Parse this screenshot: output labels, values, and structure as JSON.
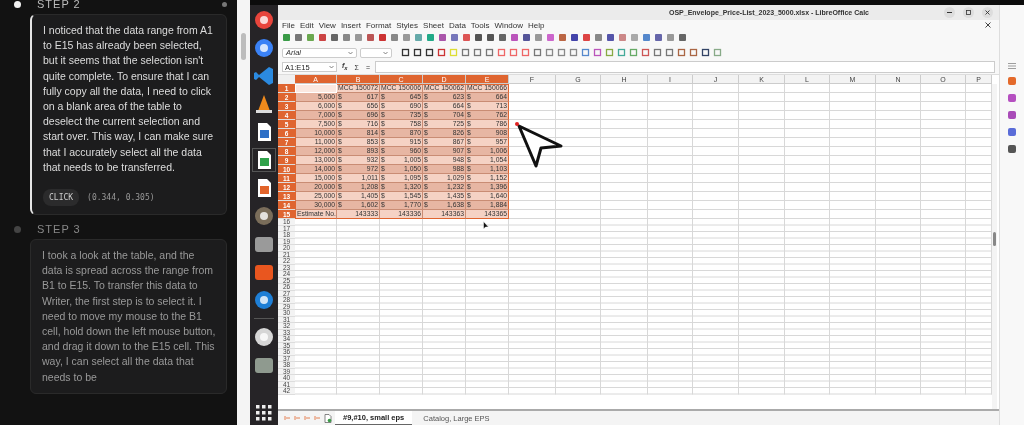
{
  "steps": [
    {
      "label": "STEP 2",
      "selected": true,
      "text": "I noticed that the data range from A1 to E15 has already been selected, but it seems that the selection isn't quite complete. To ensure that I can fully copy all the data, I need to click on a blank area of the table to deselect the current selection and start over. This way, I can make sure that I accurately select all the data that needs to be transferred.",
      "action": {
        "type": "CLICK",
        "coords": "(0.344, 0.305)"
      }
    },
    {
      "label": "STEP 3",
      "selected": false,
      "text": "I took a look at the table, and the data is spread across the range from B1 to E15. To transfer this data to Writer, the first step is to select it. I need to move my mouse to the B1 cell, hold down the left mouse button, and drag it down to the E15 cell. This way, I can select all the data that needs to be"
    }
  ],
  "window": {
    "title": "OSP_Envelope_Price-List_2023_5000.xlsx - LibreOffice Calc"
  },
  "menu": [
    "File",
    "Edit",
    "View",
    "Insert",
    "Format",
    "Styles",
    "Sheet",
    "Data",
    "Tools",
    "Window",
    "Help"
  ],
  "toolbar": {
    "font_name": "Arial"
  },
  "formula_bar": {
    "name_box": "A1:E15",
    "function_wizard": "f$_{x}$",
    "sum": "Σ",
    "equals": "="
  },
  "sheet": {
    "columns": [
      {
        "label": "A",
        "selected": true
      },
      {
        "label": "B",
        "selected": true
      },
      {
        "label": "C",
        "selected": true
      },
      {
        "label": "D",
        "selected": true
      },
      {
        "label": "E",
        "selected": true
      },
      {
        "label": "F",
        "selected": false
      },
      {
        "label": "G",
        "selected": false
      },
      {
        "label": "H",
        "selected": false
      },
      {
        "label": "I",
        "selected": false
      },
      {
        "label": "J",
        "selected": false
      },
      {
        "label": "K",
        "selected": false
      },
      {
        "label": "L",
        "selected": false
      },
      {
        "label": "M",
        "selected": false
      },
      {
        "label": "N",
        "selected": false
      },
      {
        "label": "O",
        "selected": false
      },
      {
        "label": "P",
        "selected": false
      }
    ],
    "rows": [
      {
        "number": "1",
        "selected": true,
        "kind": "header",
        "cells": [
          "",
          "MCC 150072",
          "MCC 150006",
          "MCC 150062",
          "MCC 150066"
        ]
      },
      {
        "number": "2",
        "selected": true,
        "kind": "data",
        "cells": [
          "5,000",
          {
            "symbol": "$",
            "amount": "617"
          },
          {
            "symbol": "$",
            "amount": "645"
          },
          {
            "symbol": "$",
            "amount": "623"
          },
          {
            "symbol": "$",
            "amount": "664"
          }
        ]
      },
      {
        "number": "3",
        "selected": true,
        "kind": "data",
        "cells": [
          "6,000",
          {
            "symbol": "$",
            "amount": "656"
          },
          {
            "symbol": "$",
            "amount": "690"
          },
          {
            "symbol": "$",
            "amount": "664"
          },
          {
            "symbol": "$",
            "amount": "713"
          }
        ]
      },
      {
        "number": "4",
        "selected": true,
        "kind": "data",
        "cells": [
          "7,000",
          {
            "symbol": "$",
            "amount": "696"
          },
          {
            "symbol": "$",
            "amount": "735"
          },
          {
            "symbol": "$",
            "amount": "704"
          },
          {
            "symbol": "$",
            "amount": "762"
          }
        ]
      },
      {
        "number": "5",
        "selected": true,
        "kind": "data",
        "cells": [
          "7,500",
          {
            "symbol": "$",
            "amount": "716"
          },
          {
            "symbol": "$",
            "amount": "758"
          },
          {
            "symbol": "$",
            "amount": "725"
          },
          {
            "symbol": "$",
            "amount": "786"
          }
        ]
      },
      {
        "number": "6",
        "selected": true,
        "kind": "data",
        "cells": [
          "10,000",
          {
            "symbol": "$",
            "amount": "814"
          },
          {
            "symbol": "$",
            "amount": "870"
          },
          {
            "symbol": "$",
            "amount": "826"
          },
          {
            "symbol": "$",
            "amount": "908"
          }
        ]
      },
      {
        "number": "7",
        "selected": true,
        "kind": "data",
        "cells": [
          "11,000",
          {
            "symbol": "$",
            "amount": "853"
          },
          {
            "symbol": "$",
            "amount": "915"
          },
          {
            "symbol": "$",
            "amount": "867"
          },
          {
            "symbol": "$",
            "amount": "957"
          }
        ]
      },
      {
        "number": "8",
        "selected": true,
        "kind": "data",
        "cells": [
          "12,000",
          {
            "symbol": "$",
            "amount": "893"
          },
          {
            "symbol": "$",
            "amount": "960"
          },
          {
            "symbol": "$",
            "amount": "907"
          },
          {
            "symbol": "$",
            "amount": "1,006"
          }
        ]
      },
      {
        "number": "9",
        "selected": true,
        "kind": "data",
        "cells": [
          "13,000",
          {
            "symbol": "$",
            "amount": "932"
          },
          {
            "symbol": "$",
            "amount": "1,005"
          },
          {
            "symbol": "$",
            "amount": "948"
          },
          {
            "symbol": "$",
            "amount": "1,054"
          }
        ]
      },
      {
        "number": "10",
        "selected": true,
        "kind": "data",
        "cells": [
          "14,000",
          {
            "symbol": "$",
            "amount": "972"
          },
          {
            "symbol": "$",
            "amount": "1,050"
          },
          {
            "symbol": "$",
            "amount": "988"
          },
          {
            "symbol": "$",
            "amount": "1,103"
          }
        ]
      },
      {
        "number": "11",
        "selected": true,
        "kind": "data",
        "cells": [
          "15,000",
          {
            "symbol": "$",
            "amount": "1,011"
          },
          {
            "symbol": "$",
            "amount": "1,095"
          },
          {
            "symbol": "$",
            "amount": "1,029"
          },
          {
            "symbol": "$",
            "amount": "1,152"
          }
        ]
      },
      {
        "number": "12",
        "selected": true,
        "kind": "data",
        "cells": [
          "20,000",
          {
            "symbol": "$",
            "amount": "1,208"
          },
          {
            "symbol": "$",
            "amount": "1,320"
          },
          {
            "symbol": "$",
            "amount": "1,232"
          },
          {
            "symbol": "$",
            "amount": "1,396"
          }
        ]
      },
      {
        "number": "13",
        "selected": true,
        "kind": "data",
        "cells": [
          "25,000",
          {
            "symbol": "$",
            "amount": "1,405"
          },
          {
            "symbol": "$",
            "amount": "1,545"
          },
          {
            "symbol": "$",
            "amount": "1,435"
          },
          {
            "symbol": "$",
            "amount": "1,640"
          }
        ]
      },
      {
        "number": "14",
        "selected": true,
        "kind": "data",
        "cells": [
          "30,000",
          {
            "symbol": "$",
            "amount": "1,602"
          },
          {
            "symbol": "$",
            "amount": "1,770"
          },
          {
            "symbol": "$",
            "amount": "1,638"
          },
          {
            "symbol": "$",
            "amount": "1,884"
          }
        ]
      },
      {
        "number": "15",
        "selected": true,
        "kind": "total",
        "cells": [
          "Estimate No.",
          "143333",
          "143336",
          "143363",
          "143365"
        ]
      },
      {
        "number": "16",
        "selected": false
      },
      {
        "number": "17",
        "selected": false
      },
      {
        "number": "18",
        "selected": false
      },
      {
        "number": "19",
        "selected": false
      },
      {
        "number": "20",
        "selected": false
      },
      {
        "number": "21",
        "selected": false
      },
      {
        "number": "22",
        "selected": false
      },
      {
        "number": "23",
        "selected": false
      },
      {
        "number": "24",
        "selected": false
      },
      {
        "number": "25",
        "selected": false
      },
      {
        "number": "26",
        "selected": false
      },
      {
        "number": "27",
        "selected": false
      },
      {
        "number": "28",
        "selected": false
      },
      {
        "number": "29",
        "selected": false
      },
      {
        "number": "30",
        "selected": false
      },
      {
        "number": "31",
        "selected": false
      },
      {
        "number": "32",
        "selected": false
      },
      {
        "number": "33",
        "selected": false
      },
      {
        "number": "34",
        "selected": false
      },
      {
        "number": "35",
        "selected": false
      },
      {
        "number": "36",
        "selected": false
      },
      {
        "number": "37",
        "selected": false
      },
      {
        "number": "38",
        "selected": false
      },
      {
        "number": "39",
        "selected": false
      },
      {
        "number": "40",
        "selected": false
      },
      {
        "number": "41",
        "selected": false
      },
      {
        "number": "42",
        "selected": false
      }
    ]
  },
  "sheet_tabs": [
    {
      "label": "#9,#10, small eps",
      "selected": true
    },
    {
      "label": "Catalog, Large EPS",
      "selected": false
    }
  ]
}
